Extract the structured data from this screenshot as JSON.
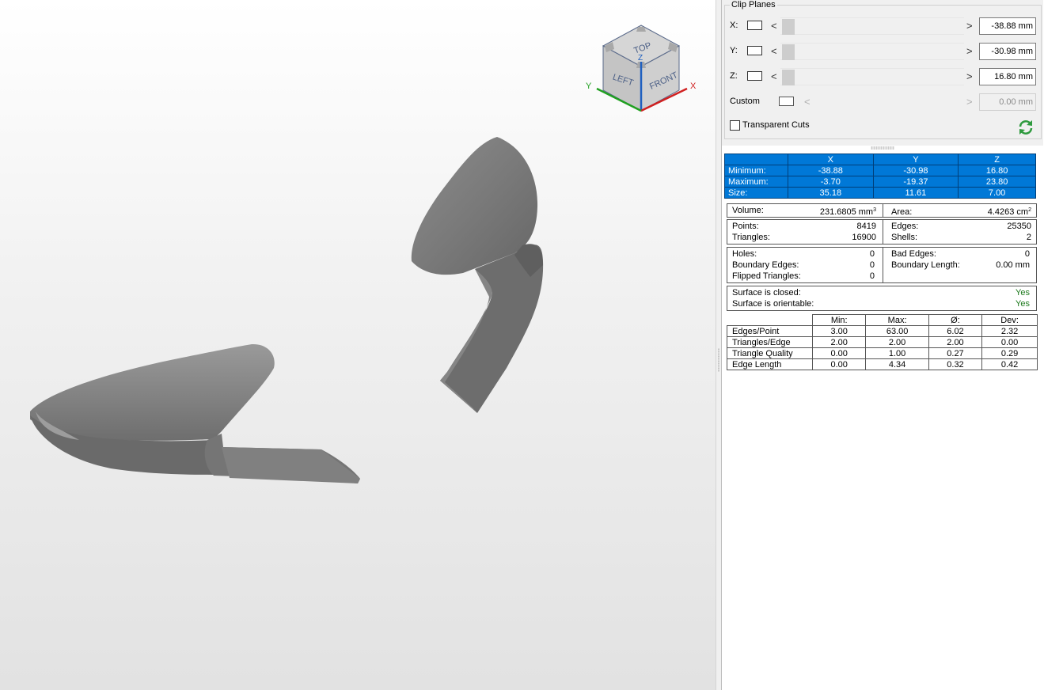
{
  "viewcube": {
    "faces": {
      "top": "TOP",
      "left": "LEFT",
      "front": "FRONT"
    },
    "axes": {
      "x": "X",
      "y": "Y",
      "z": "Z"
    },
    "colors": {
      "x": "#d02020",
      "y": "#20a020",
      "z": "#2060c0"
    }
  },
  "clip_planes": {
    "title": "Clip Planes",
    "rows": [
      {
        "label": "X:",
        "value": "-38.88 mm",
        "enabled": true
      },
      {
        "label": "Y:",
        "value": "-30.98 mm",
        "enabled": true
      },
      {
        "label": "Z:",
        "value": "16.80 mm",
        "enabled": true
      },
      {
        "label": "Custom",
        "value": "0.00 mm",
        "enabled": false
      }
    ],
    "transparent_cuts_label": "Transparent Cuts",
    "arrow_left": "<",
    "arrow_right": ">"
  },
  "bounding_box": {
    "headers": [
      "X",
      "Y",
      "Z"
    ],
    "rows": [
      {
        "label": "Minimum:",
        "values": [
          "-38.88",
          "-30.98",
          "16.80"
        ]
      },
      {
        "label": "Maximum:",
        "values": [
          "-3.70",
          "-19.37",
          "23.80"
        ]
      },
      {
        "label": "Size:",
        "values": [
          "35.18",
          "11.61",
          "7.00"
        ]
      }
    ],
    "highlight_color": "#0078d7"
  },
  "measures": {
    "volume_label": "Volume:",
    "volume_value": "231.6805 mm",
    "area_label": "Area:",
    "area_value": "4.4263 cm",
    "points_label": "Points:",
    "points_value": "8419",
    "edges_label": "Edges:",
    "edges_value": "25350",
    "triangles_label": "Triangles:",
    "triangles_value": "16900",
    "shells_label": "Shells:",
    "shells_value": "2",
    "holes_label": "Holes:",
    "holes_value": "0",
    "bad_edges_label": "Bad Edges:",
    "bad_edges_value": "0",
    "boundary_edges_label": "Boundary Edges:",
    "boundary_edges_value": "0",
    "boundary_length_label": "Boundary Length:",
    "boundary_length_value": "0.00 mm",
    "flipped_label": "Flipped Triangles:",
    "flipped_value": "0",
    "closed_label": "Surface is closed:",
    "closed_value": "Yes",
    "orientable_label": "Surface is orientable:",
    "orientable_value": "Yes",
    "status_color": "#1e7a1e"
  },
  "statistics": {
    "headers": [
      "Min:",
      "Max:",
      "Ø:",
      "Dev:"
    ],
    "rows": [
      {
        "label": "Edges/Point",
        "values": [
          "3.00",
          "63.00",
          "6.02",
          "2.32"
        ]
      },
      {
        "label": "Triangles/Edge",
        "values": [
          "2.00",
          "2.00",
          "2.00",
          "0.00"
        ]
      },
      {
        "label": "Triangle Quality",
        "values": [
          "0.00",
          "1.00",
          "0.27",
          "0.29"
        ]
      },
      {
        "label": "Edge Length",
        "values": [
          "0.00",
          "4.34",
          "0.32",
          "0.42"
        ]
      }
    ]
  }
}
